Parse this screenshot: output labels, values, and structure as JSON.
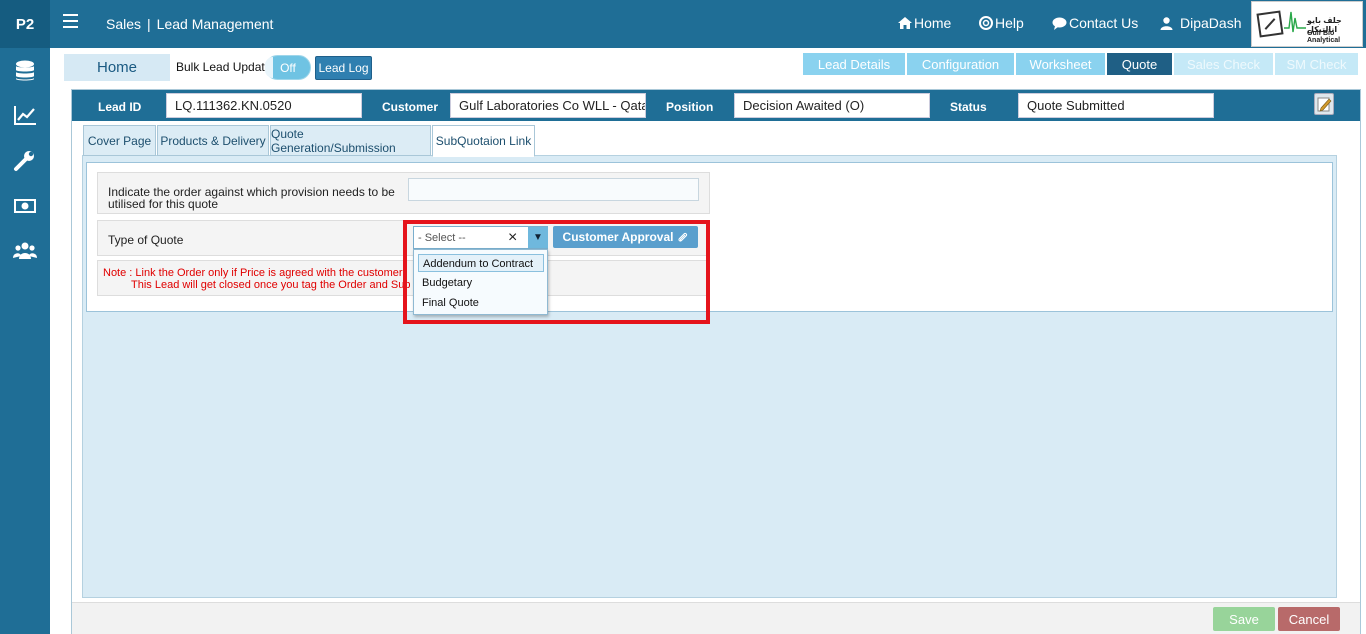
{
  "brand": "P2",
  "breadcrumb": {
    "section": "Sales",
    "separator": "|",
    "page": "Lead Management"
  },
  "topnav": {
    "home": "Home",
    "help": "Help",
    "contact": "Contact Us",
    "user": "DipaDash"
  },
  "logo": {
    "arabic": "جلف بايو انالتيكل",
    "english": "Gulf Bio Analytical"
  },
  "sidebar": {
    "icons": [
      "database-icon",
      "chart-line-icon",
      "wrench-icon",
      "money-icon",
      "users-icon"
    ]
  },
  "toolbar": {
    "home": "Home",
    "bulk_label": "Bulk Lead Update",
    "toggle": "Off",
    "lead_log": "Lead Log"
  },
  "right_tabs": [
    {
      "label": "Lead Details",
      "state": "normal"
    },
    {
      "label": "Configuration",
      "state": "normal"
    },
    {
      "label": "Worksheet",
      "state": "normal"
    },
    {
      "label": "Quote",
      "state": "active"
    },
    {
      "label": "Sales Check",
      "state": "disabled"
    },
    {
      "label": "SM Check",
      "state": "disabled"
    }
  ],
  "lead_header": {
    "lead_id_label": "Lead ID",
    "lead_id": "LQ.111362.KN.0520",
    "customer_label": "Customer",
    "customer": "Gulf Laboratories Co WLL - Qatar",
    "position_label": "Position",
    "position": "Decision Awaited (O)",
    "status_label": "Status",
    "status": "Quote Submitted"
  },
  "sub_tabs": [
    {
      "label": "Cover Page"
    },
    {
      "label": "Products & Delivery"
    },
    {
      "label": "Quote Generation/Submission"
    },
    {
      "label": "SubQuotaion Link",
      "active": true
    }
  ],
  "form": {
    "order_label_line1": "Indicate the order against which provision needs to be",
    "order_label_line2": "utilised for this quote",
    "order_value": "",
    "type_label": "Type of Quote",
    "select_placeholder": "- Select --",
    "clear": "×",
    "arrow": "▼",
    "options": [
      "Addendum to Contract",
      "Budgetary",
      "Final Quote"
    ],
    "customer_approval": "Customer Approval",
    "note_line1": "Note : Link the Order only if Price is agreed with the customer",
    "note_line2": "This Lead will get closed once you tag the Order and Sub"
  },
  "footer": {
    "save": "Save",
    "cancel": "Cancel"
  },
  "colors": {
    "primary": "#1f6e96",
    "highlight": "#e5141c",
    "save": "#98d49a",
    "cancel": "#b86a6a"
  }
}
